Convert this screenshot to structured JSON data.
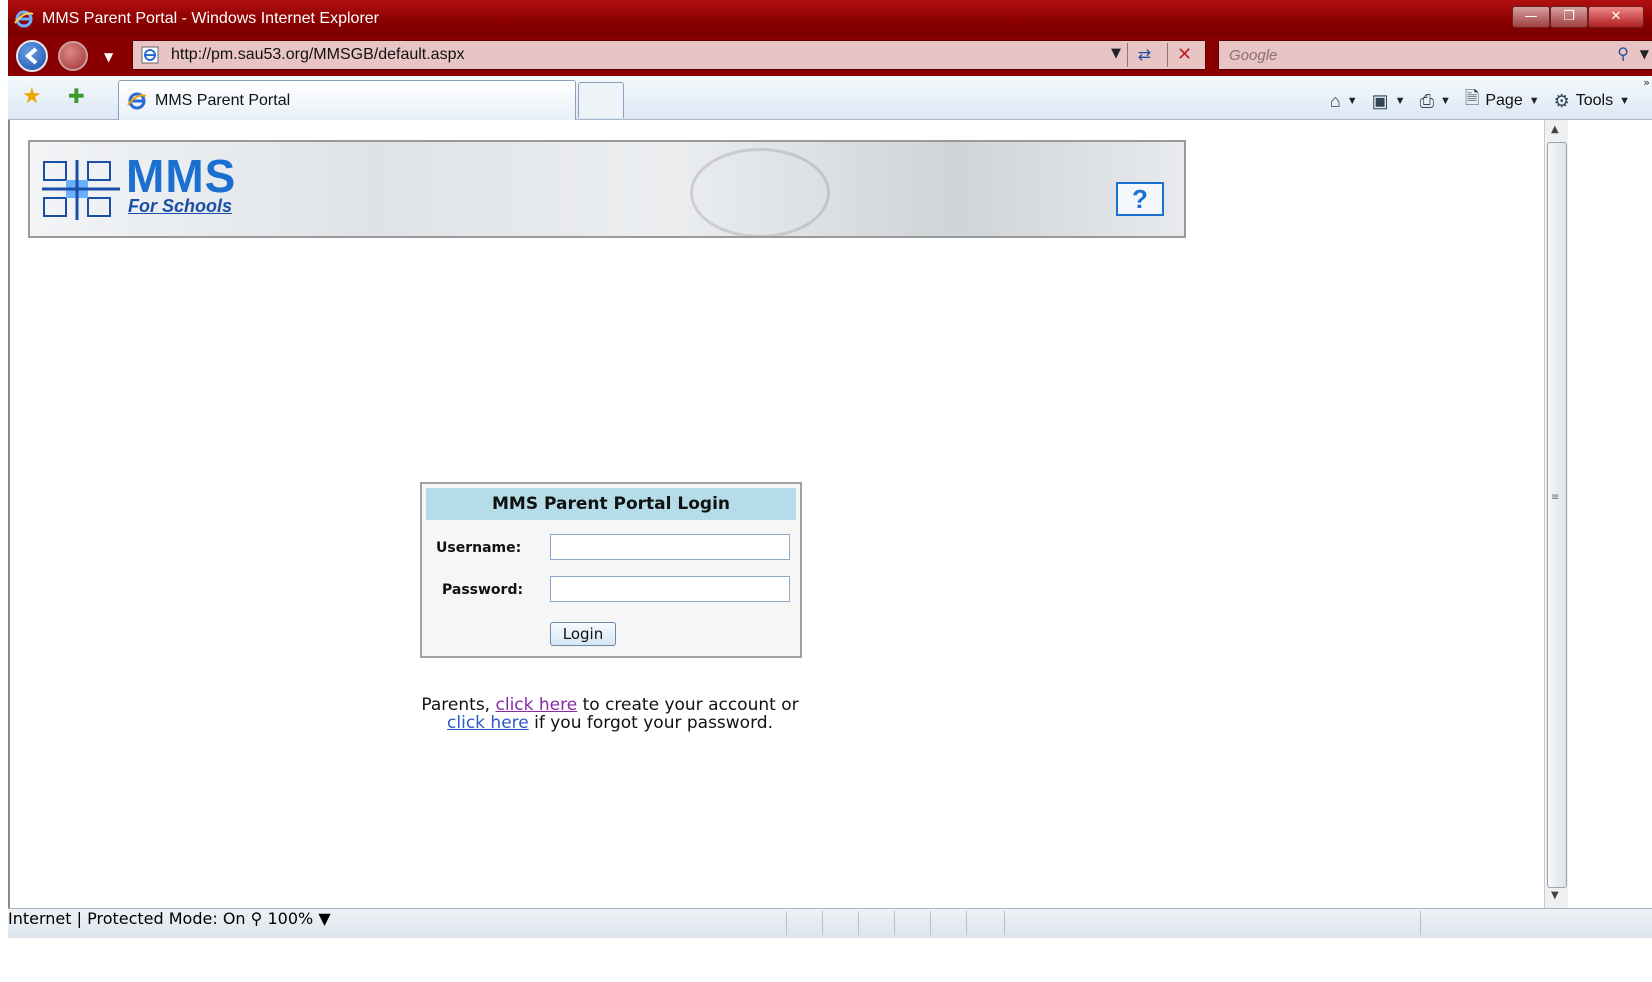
{
  "window": {
    "title": "MMS Parent Portal - Windows Internet Explorer"
  },
  "address_bar": {
    "url": "http://pm.sau53.org/MMSGB/default.aspx"
  },
  "search": {
    "placeholder": "Google"
  },
  "tab": {
    "label": "MMS Parent Portal"
  },
  "commands": {
    "page_label": "Page",
    "tools_label": "Tools"
  },
  "banner": {
    "logo_main": "MMS",
    "logo_sub": "For Schools",
    "help_label": "?"
  },
  "login": {
    "title": "MMS Parent Portal Login",
    "username_label": "Username:",
    "password_label": "Password:",
    "username_value": "",
    "password_value": "",
    "button_label": "Login"
  },
  "parents_note": {
    "prefix": "Parents, ",
    "link1": "click here",
    "middle": " to create your account or",
    "link2": "click here",
    "suffix": " if you forgot your password."
  },
  "status": {
    "zone": "Internet | Protected Mode: On",
    "zoom": "100%"
  }
}
